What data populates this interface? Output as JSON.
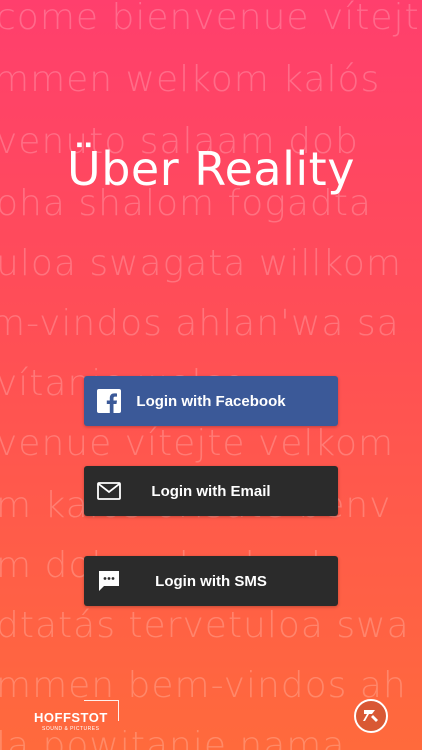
{
  "app": {
    "title": "Über Reality"
  },
  "background_words": [
    "come   bienvenue   vítejte",
    "mmen   welkom   kalós",
    "venuto   salaam   dob",
    "oha   shalom   fogadta",
    "uloa   swagata   willkom",
    "m-vindos   ahlan'wa sa",
    "vítanie   welco",
    "venue   vítejte   velkom",
    "m   kalós orisate   benv",
    "m   dobro   dos   la   sh",
    "dtatás   tervetuloa   swa",
    "mmen bem-vindos   ah",
    "la   powitanie   nama"
  ],
  "buttons": {
    "facebook": {
      "label": "Login with Facebook",
      "icon": "facebook-icon",
      "color": "#3b5998"
    },
    "email": {
      "label": "Login with Email",
      "icon": "envelope-icon",
      "color": "#2b2b2b"
    },
    "sms": {
      "label": "Login with SMS",
      "icon": "sms-bubble-icon",
      "color": "#2b2b2b"
    }
  },
  "footer": {
    "brand_name": "HOFFSTOT",
    "brand_sub": "SOUND & PICTURES",
    "corner_icon": "studio-logo-icon"
  },
  "colors": {
    "gradient_top": "#ff3f6d",
    "gradient_mid": "#ff4f55",
    "gradient_bottom": "#ff6a3c"
  }
}
